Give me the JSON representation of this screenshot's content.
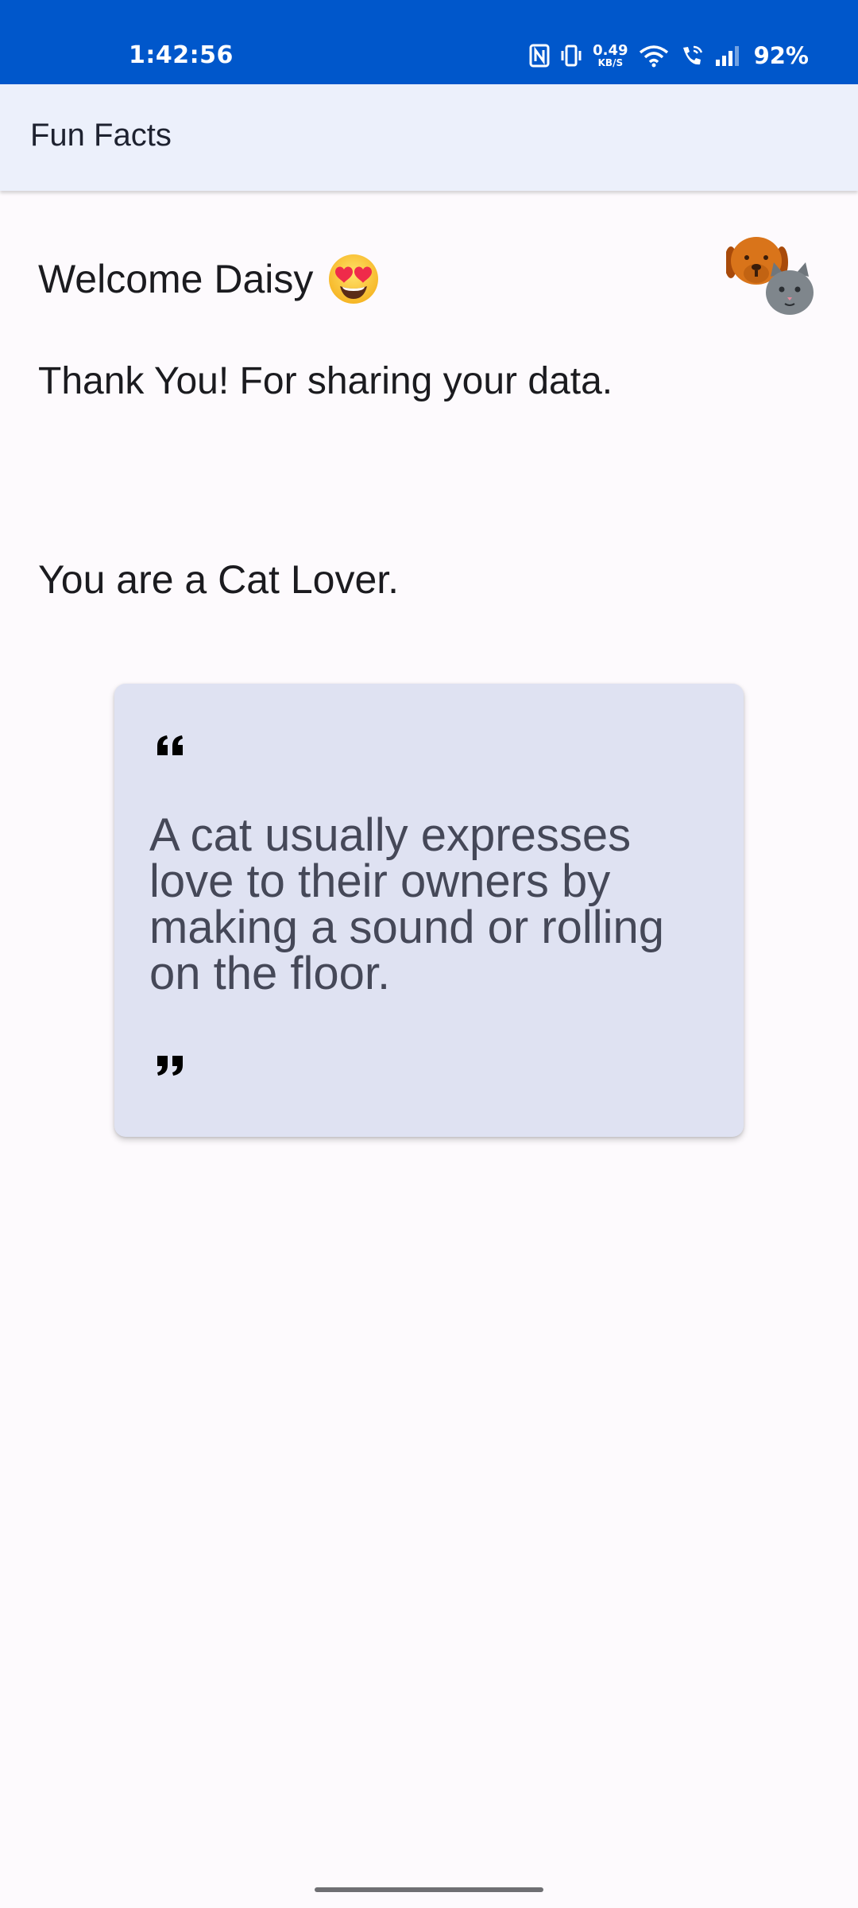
{
  "status_bar": {
    "time": "1:42:56",
    "net_speed_value": "0.49",
    "net_speed_unit": "KB/S",
    "battery": "92%",
    "icons": [
      "nfc-icon",
      "vibrate-icon",
      "wifi-icon",
      "wifi-calling-icon",
      "signal-icon"
    ],
    "background_color": "#0057cb"
  },
  "app_bar": {
    "title": "Fun Facts",
    "background_color": "#ecf0fb"
  },
  "main": {
    "welcome_text": "Welcome Daisy",
    "welcome_emoji": "smiling-face-with-heart-eyes-icon",
    "pets_icon": "dog-and-cat-icon",
    "thanks_text": "Thank You! For sharing your data.",
    "lover_text": "You are a Cat Lover."
  },
  "quote_card": {
    "text": "A cat usually expresses love to their owners by making a sound or rolling on the floor.",
    "open_icon": "quote-open-icon",
    "close_icon": "quote-close-icon",
    "background_color": "#dfe2f2"
  }
}
